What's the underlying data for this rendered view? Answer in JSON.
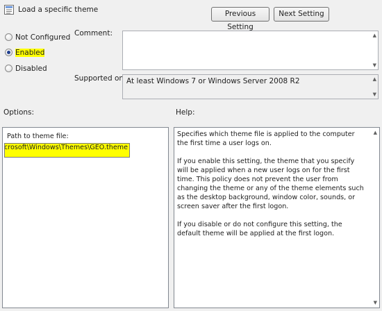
{
  "header": {
    "icon": "policy-setting-icon",
    "title": "Load a specific theme",
    "prev_button": "Previous Setting",
    "next_button": "Next Setting"
  },
  "state": {
    "options": [
      {
        "label": "Not Configured",
        "checked": false
      },
      {
        "label": "Enabled",
        "checked": true
      },
      {
        "label": "Disabled",
        "checked": false
      }
    ]
  },
  "comment": {
    "label": "Comment:",
    "value": ""
  },
  "supported": {
    "label": "Supported on:",
    "value": "At least Windows 7 or Windows Server 2008 R2"
  },
  "options_pane": {
    "heading": "Options:",
    "path_label": "Path to theme file:",
    "path_value": "\\Microsoft\\Windows\\Themes\\GEO.theme"
  },
  "help_pane": {
    "heading": "Help:",
    "paragraphs": [
      "Specifies which theme file is applied to the computer the first time a user logs on.",
      "If you enable this setting, the theme that you specify will be applied when a new user logs on for the first time.  This policy does not prevent the user from changing the theme or any of the theme elements such as the desktop background, window color, sounds, or screen saver after the first logon.",
      "If you disable or do not configure this setting, the default theme will be applied at the first logon."
    ]
  },
  "colors": {
    "highlight": "#ffff00",
    "selection": "#1f3f8f"
  }
}
